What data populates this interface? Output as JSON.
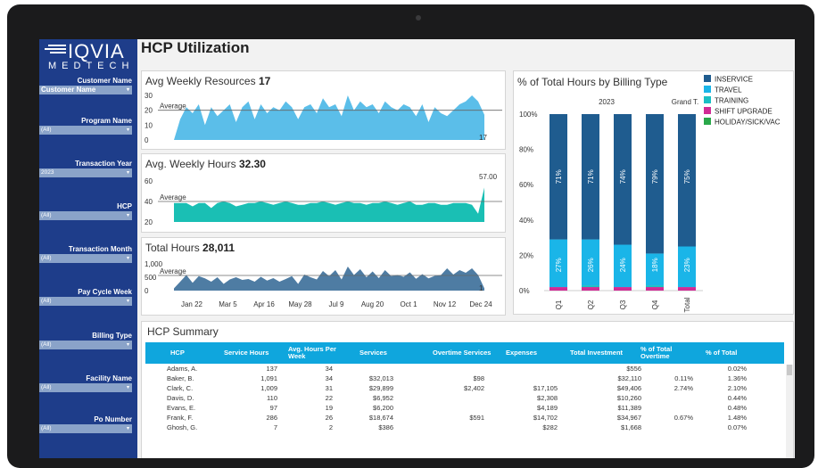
{
  "brand": {
    "name": "IQVIA",
    "sub": "MEDTECH"
  },
  "dashboard_title": "HCP Utilization",
  "filters": [
    {
      "label": "Customer Name",
      "value": "Customer Name"
    },
    {
      "label": "Program Name",
      "value": "(All)"
    },
    {
      "label": "Transaction Year",
      "value": "2023"
    },
    {
      "label": "HCP",
      "value": "(All)"
    },
    {
      "label": "Transaction Month",
      "value": "(All)"
    },
    {
      "label": "Pay Cycle Week",
      "value": "(All)"
    },
    {
      "label": "Billing Type",
      "value": "(All)"
    },
    {
      "label": "Facility Name",
      "value": "(All)"
    },
    {
      "label": "Po Number",
      "value": "(All)"
    }
  ],
  "cards": {
    "resources": {
      "title": "Avg Weekly Resources",
      "value": "17",
      "average_label": "Average",
      "end_label": "17"
    },
    "hours": {
      "title": "Avg. Weekly Hours",
      "value": "32.30",
      "average_label": "Average",
      "end_label": "57.00"
    },
    "total": {
      "title": "Total Hours",
      "value": "28,011",
      "average_label": "Average",
      "end_label": "1"
    }
  },
  "x_ticks": [
    "Jan 22",
    "Mar 5",
    "Apr 16",
    "May 28",
    "Jul 9",
    "Aug 20",
    "Oct 1",
    "Nov 12",
    "Dec 24"
  ],
  "chart_data": [
    {
      "type": "area",
      "title": "Avg Weekly Resources",
      "yticks": [
        "30",
        "20",
        "10",
        "0"
      ],
      "ylim": [
        0,
        30
      ],
      "average": 20,
      "values": [
        0,
        14,
        22,
        18,
        24,
        10,
        22,
        16,
        20,
        24,
        12,
        22,
        26,
        14,
        24,
        18,
        22,
        20,
        26,
        22,
        14,
        22,
        24,
        18,
        28,
        22,
        24,
        16,
        30,
        20,
        26,
        22,
        24,
        18,
        26,
        22,
        20,
        24,
        22,
        16,
        24,
        12,
        22,
        18,
        16,
        20,
        24,
        26,
        30,
        26,
        17
      ]
    },
    {
      "type": "area",
      "title": "Avg. Weekly Hours",
      "yticks": [
        "60",
        "40",
        "20"
      ],
      "ylim": [
        15,
        65
      ],
      "average": 40,
      "values": [
        38,
        38,
        38,
        34,
        38,
        38,
        32,
        38,
        40,
        38,
        34,
        36,
        38,
        38,
        40,
        38,
        36,
        38,
        40,
        38,
        36,
        36,
        38,
        38,
        40,
        38,
        36,
        38,
        40,
        38,
        38,
        36,
        38,
        38,
        40,
        38,
        36,
        38,
        40,
        36,
        36,
        38,
        38,
        36,
        36,
        38,
        38,
        38,
        36,
        25,
        57
      ]
    },
    {
      "type": "area",
      "title": "Total Hours",
      "yticks": [
        "1,000",
        "500",
        "0"
      ],
      "ylim": [
        -100,
        1100
      ],
      "average": 580,
      "values": [
        0,
        300,
        600,
        250,
        550,
        450,
        300,
        500,
        200,
        400,
        500,
        380,
        420,
        300,
        520,
        350,
        460,
        300,
        420,
        550,
        200,
        620,
        500,
        400,
        780,
        550,
        820,
        400,
        980,
        600,
        860,
        500,
        760,
        460,
        820,
        550,
        600,
        520,
        720,
        430,
        640,
        450,
        560,
        600,
        900,
        620,
        820,
        700,
        900,
        600,
        1
      ]
    },
    {
      "type": "bar",
      "title": "% of Total Hours by Billing Type",
      "column_header": "2023",
      "grand_header": "Grand T.",
      "categories": [
        "Q1",
        "Q2",
        "Q3",
        "Q4",
        "Total"
      ],
      "yticks": [
        "100%",
        "80%",
        "60%",
        "40%",
        "20%",
        "0%"
      ],
      "ylim": [
        0,
        100
      ],
      "series": [
        {
          "name": "INSERVICE",
          "color": "#1f5c8f",
          "values": [
            71,
            71,
            74,
            79,
            75
          ]
        },
        {
          "name": "TRAVEL",
          "color": "#1ab5e8",
          "values": [
            27,
            26,
            24,
            18,
            23
          ]
        },
        {
          "name": "TRAINING",
          "color": "#1abfc4",
          "values": [
            0,
            1,
            0,
            1,
            0
          ]
        },
        {
          "name": "SHIFT UPGRADE",
          "color": "#d12c95",
          "values": [
            2,
            2,
            2,
            2,
            2
          ]
        },
        {
          "name": "HOLIDAY/SICK/VAC",
          "color": "#2aa84a",
          "values": [
            0,
            0,
            0,
            0,
            0
          ]
        }
      ],
      "bar_labels": [
        {
          "top": "71%",
          "bottom": "27%"
        },
        {
          "top": "71%",
          "bottom": "26%"
        },
        {
          "top": "74%",
          "bottom": "24%"
        },
        {
          "top": "79%",
          "bottom": "18%"
        },
        {
          "top": "75%",
          "bottom": "23%"
        }
      ]
    }
  ],
  "summary": {
    "title": "HCP Summary",
    "columns": [
      "HCP",
      "Service Hours",
      "Avg. Hours Per Week",
      "Services",
      "Overtime Services",
      "Expenses",
      "Total Investment",
      "% of Total Overtime",
      "% of Total"
    ],
    "rows": [
      [
        "Adams, A.",
        "137",
        "34",
        "",
        "",
        "",
        "$556",
        "",
        "0.02%"
      ],
      [
        "Baker, B.",
        "1,091",
        "34",
        "$32,013",
        "$98",
        "",
        "$32,110",
        "0.11%",
        "1.36%"
      ],
      [
        "Clark, C.",
        "1,009",
        "31",
        "$29,899",
        "$2,402",
        "$17,105",
        "$49,406",
        "2.74%",
        "2.10%"
      ],
      [
        "Davis, D.",
        "110",
        "22",
        "$6,952",
        "",
        "$2,308",
        "$10,260",
        "",
        "0.44%"
      ],
      [
        "Evans, E.",
        "97",
        "19",
        "$6,200",
        "",
        "$4,189",
        "$11,389",
        "",
        "0.48%"
      ],
      [
        "Frank, F.",
        "286",
        "26",
        "$18,674",
        "$591",
        "$14,702",
        "$34,967",
        "0.67%",
        "1.48%"
      ],
      [
        "Ghosh, G.",
        "7",
        "2",
        "$386",
        "",
        "$282",
        "$1,668",
        "",
        "0.07%"
      ]
    ]
  }
}
